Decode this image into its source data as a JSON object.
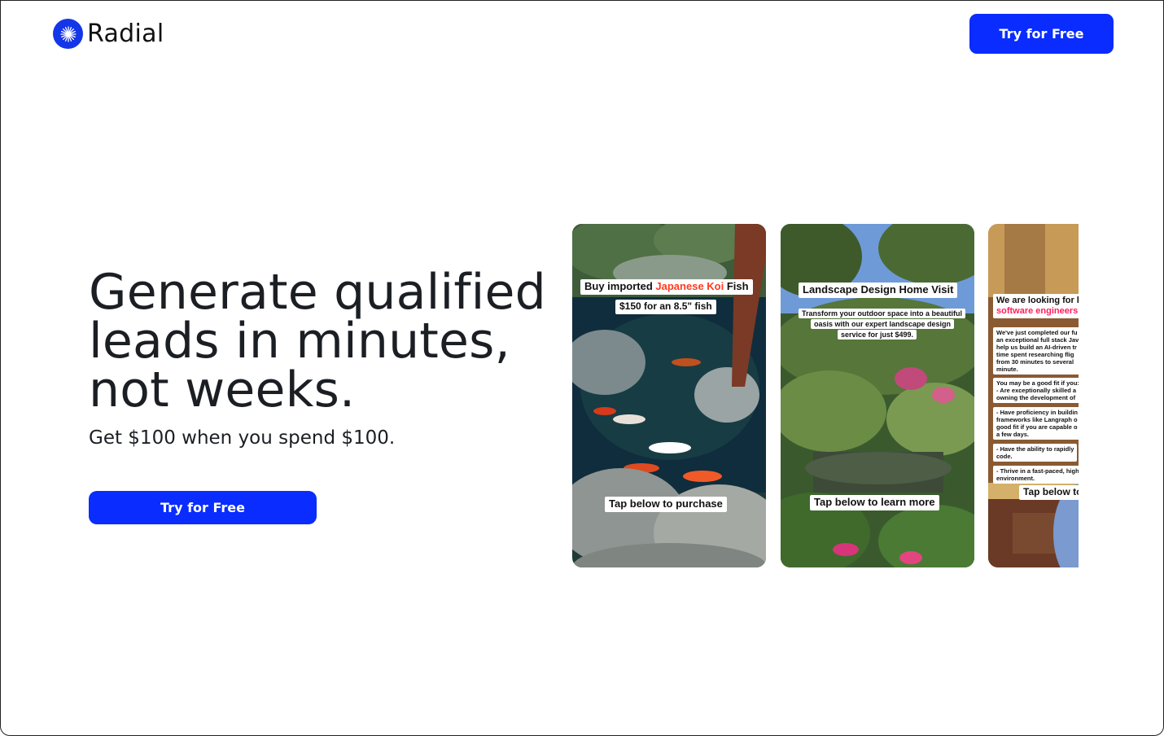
{
  "header": {
    "logo_text": "Radial",
    "logo_icon": "starburst-icon",
    "cta_label": "Try for Free"
  },
  "hero": {
    "title_lines": [
      "Generate qualified",
      "leads in minutes,",
      "not weeks."
    ],
    "subtitle": "Get $100 when you spend $100.",
    "cta_label": "Try for Free"
  },
  "colors": {
    "brand_blue": "#0a2cff",
    "koi_red": "#ff3b1f",
    "landscape_green": "#15a535",
    "jobs_pink": "#ff1d5e"
  },
  "cards": {
    "koi": {
      "headline_pre": "Buy imported ",
      "headline_highlight": "Japanese Koi",
      "headline_post": " Fish",
      "price": "$150 for an 8.5\" fish",
      "footer": "Tap below to purchase"
    },
    "landscape": {
      "headline": "Landscape Design Home Visit",
      "body_lines": [
        "Transform your outdoor space into a beautiful",
        "oasis with our expert landscape design",
        "service for just $499."
      ],
      "footer": "Tap below to learn more"
    },
    "jobs": {
      "headline": "We are looking for l",
      "headline_highlight": "software engineers",
      "para1": [
        "We've just completed our fu",
        "an exceptional full stack Jav",
        "help us build an AI-driven tr",
        "time spent researching flig",
        "from 30 minutes to several",
        "minute."
      ],
      "para2": [
        "You may be a good fit if you:",
        "- Are exceptionally skilled a",
        "owning the development of"
      ],
      "para3": [
        "- Have proficiency in buildin",
        "frameworks like Langraph o",
        "good fit if you are capable o",
        "a few days."
      ],
      "para4": [
        "- Have the ability to rapidly",
        "code."
      ],
      "para5": [
        "- Thrive in a fast-paced, high",
        "environment."
      ],
      "footer": "Tap below to"
    }
  }
}
